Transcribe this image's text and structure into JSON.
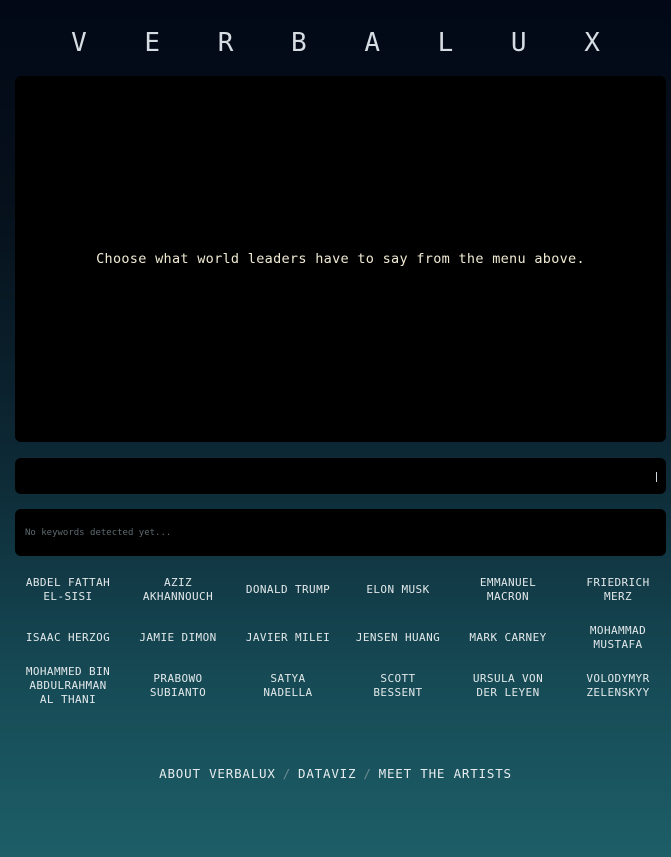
{
  "app": {
    "title": "V E R B A L U X"
  },
  "screen": {
    "message": "Choose what world leaders have to say from the menu above."
  },
  "keywords": {
    "placeholder": "No keywords detected yet..."
  },
  "leaders": [
    {
      "label": "ABDEL FATTAH\nEL-SISI"
    },
    {
      "label": "AZIZ\nAKHANNOUCH"
    },
    {
      "label": "DONALD TRUMP"
    },
    {
      "label": "ELON MUSK"
    },
    {
      "label": "EMMANUEL\nMACRON"
    },
    {
      "label": "FRIEDRICH\nMERZ"
    },
    {
      "label": "ISAAC HERZOG"
    },
    {
      "label": "JAMIE DIMON"
    },
    {
      "label": "JAVIER MILEI"
    },
    {
      "label": "JENSEN HUANG"
    },
    {
      "label": "MARK CARNEY"
    },
    {
      "label": "MOHAMMAD\nMUSTAFA"
    },
    {
      "label": "MOHAMMED BIN\nABDULRAHMAN\nAL THANI"
    },
    {
      "label": "PRABOWO\nSUBIANTO"
    },
    {
      "label": "SATYA\nNADELLA"
    },
    {
      "label": "SCOTT\nBESSENT"
    },
    {
      "label": "URSULA VON\nDER LEYEN"
    },
    {
      "label": "VOLODYMYR\nZELENSKYY"
    }
  ],
  "footer": {
    "about": "ABOUT VERBALUX",
    "dataviz": "DATAVIZ",
    "artists": "MEET THE ARTISTS",
    "separator": "/"
  }
}
